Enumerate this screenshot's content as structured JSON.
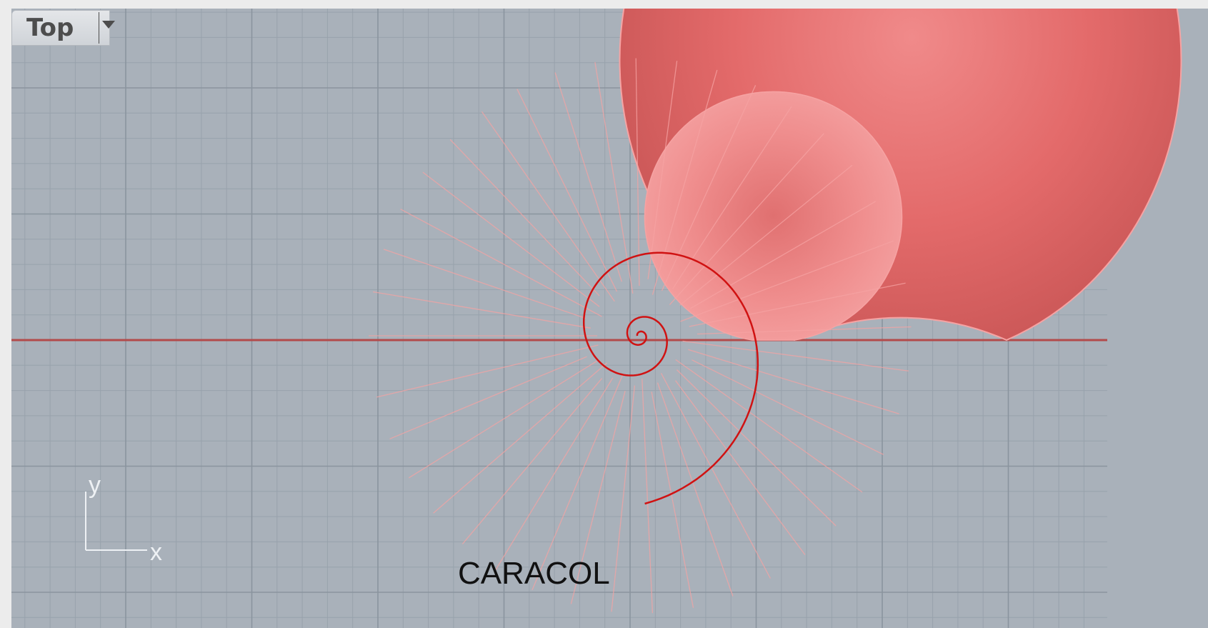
{
  "viewport": {
    "name": "Top",
    "axis_x_label": "x",
    "axis_y_label": "y",
    "colors": {
      "background": "#a9b1ba",
      "grid_minor": "#98a2ac",
      "grid_major": "#8a949e",
      "x_axis": "#b24b4b",
      "shell_fill": "#e86d6d",
      "shell_edge": "#f6a3a3",
      "spiral_curve": "#d01212"
    }
  },
  "caption": "CARACOL"
}
